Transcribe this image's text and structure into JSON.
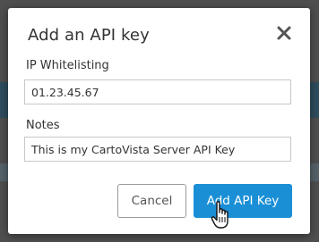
{
  "dialog": {
    "title": "Add an API key",
    "close_icon": "close-icon"
  },
  "fields": {
    "ip": {
      "label": "IP Whitelisting",
      "value": "01.23.45.67"
    },
    "notes": {
      "label": "Notes",
      "value": "This is my CartoVista Server API Key"
    }
  },
  "buttons": {
    "cancel_label": "Cancel",
    "add_label": "Add API Key"
  },
  "colors": {
    "accent": "#1a8fd6",
    "text": "#333333",
    "overlay": "#4f4f4f"
  },
  "pointer": "hand-pointer-cursor"
}
